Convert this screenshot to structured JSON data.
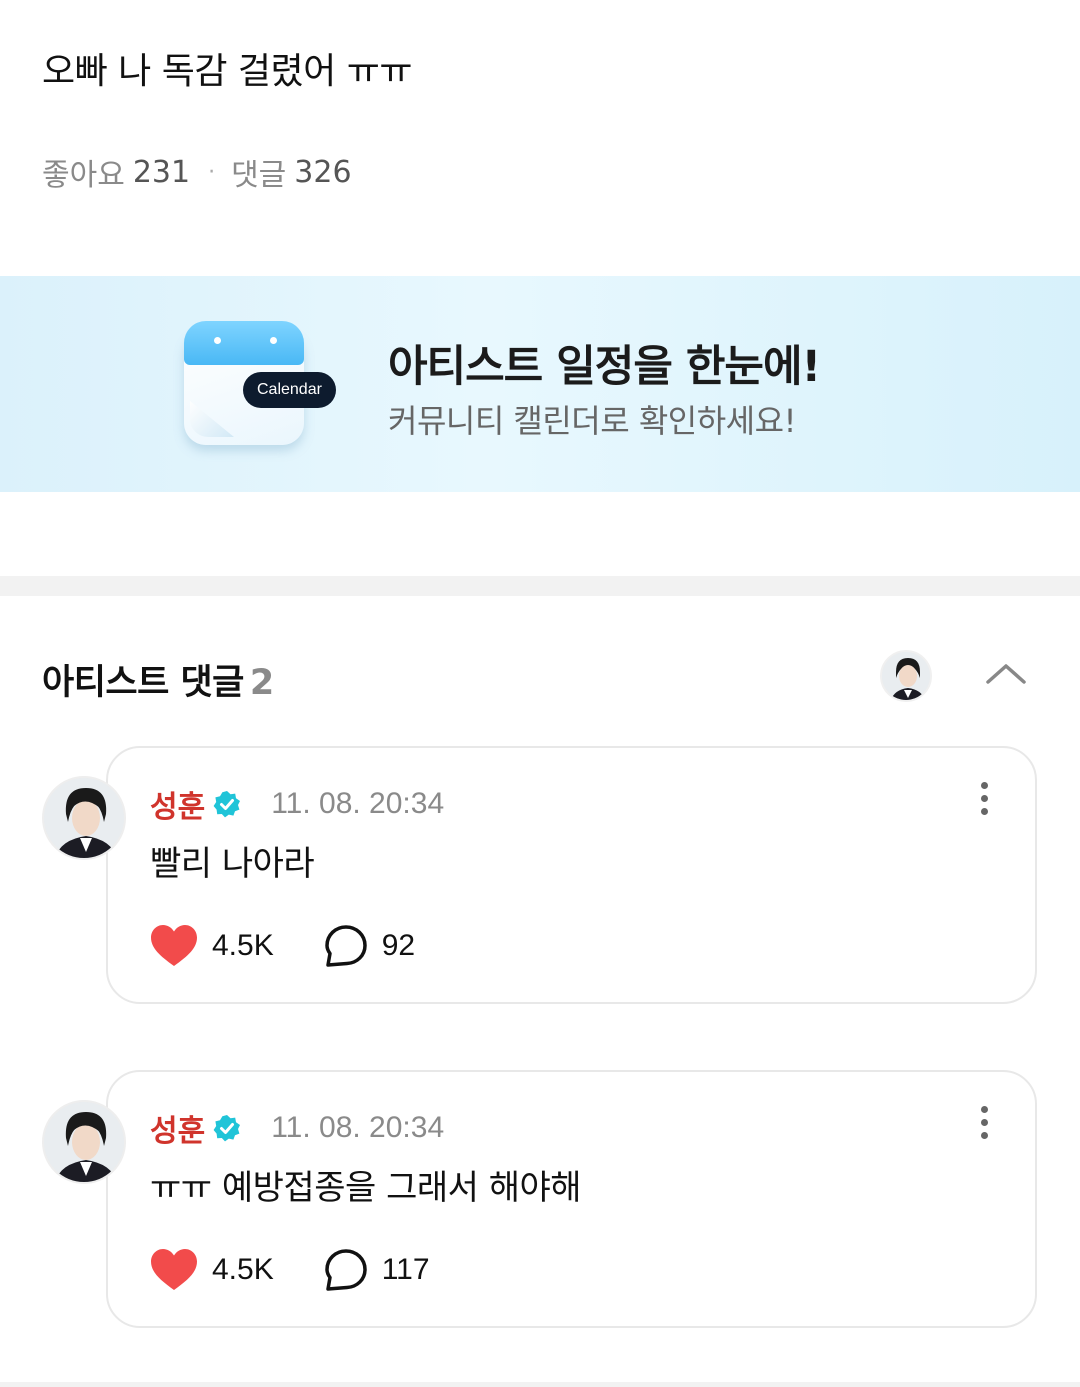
{
  "post": {
    "title": "오빠 나 독감 걸렸어 ㅠㅠ",
    "likes_label": "좋아요",
    "likes_count": "231",
    "comments_label": "댓글",
    "comments_count": "326"
  },
  "banner": {
    "calendar_label": "Calendar",
    "title": "아티스트 일정을 한눈에!",
    "subtitle": "커뮤니티 캘린더로 확인하세요!"
  },
  "artist_comments": {
    "title": "아티스트 댓글",
    "count": "2",
    "comments": [
      {
        "author": "성훈",
        "time": "11. 08. 20:34",
        "text": "빨리 나아라",
        "likes": "4.5K",
        "replies": "92"
      },
      {
        "author": "성훈",
        "time": "11. 08. 20:34",
        "text": "ㅠㅠ 예방접종을 그래서 해야해",
        "likes": "4.5K",
        "replies": "117"
      }
    ]
  },
  "icons": {
    "verified": "verified-badge-icon",
    "more": "more-vertical-icon",
    "like": "heart-icon",
    "reply": "speech-bubble-icon",
    "collapse": "chevron-up-icon"
  },
  "colors": {
    "author_name": "#d0342c",
    "verified": "#20c4d8",
    "heart": "#f24b4b",
    "banner_bg": "#e3f5fd"
  }
}
